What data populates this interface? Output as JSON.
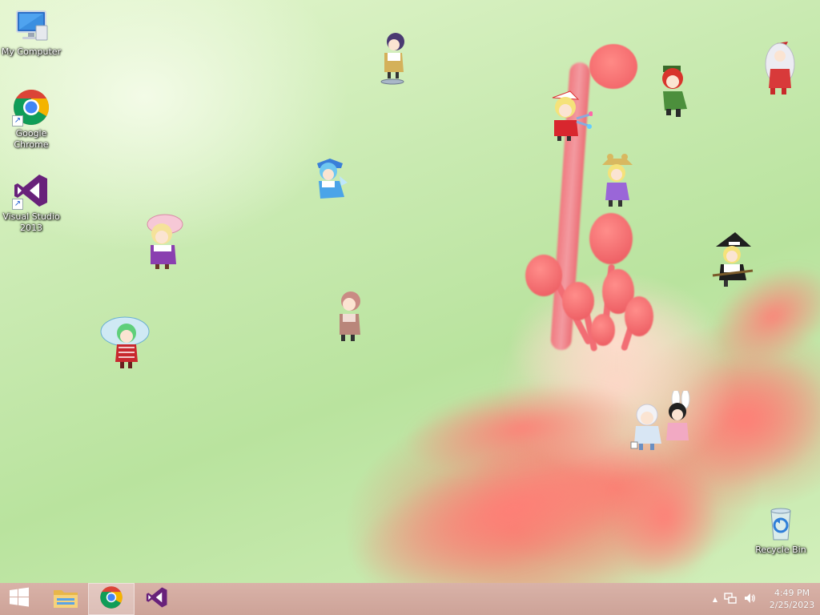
{
  "desktop_icons": [
    {
      "label": "My Computer",
      "icon": "computer-icon"
    },
    {
      "label": "Google Chrome",
      "icon": "chrome-icon"
    },
    {
      "label": "Visual Studio 2013",
      "icon": "visual-studio-icon"
    },
    {
      "label": "Recycle Bin",
      "icon": "recycle-bin-icon"
    }
  ],
  "taskbar": {
    "start_icon": "windows-start-icon",
    "pinned": [
      {
        "name": "File Explorer",
        "icon": "folder-icon",
        "active": false
      },
      {
        "name": "Google Chrome",
        "icon": "chrome-icon",
        "active": true
      },
      {
        "name": "Visual Studio",
        "icon": "visual-studio-icon",
        "active": false
      }
    ],
    "tray": {
      "overflow_glyph": "▲",
      "network_icon": "network-icon",
      "volume_icon": "speaker-icon",
      "time": "4:49 PM",
      "date": "2/25/2023"
    }
  },
  "colors": {
    "taskbar": "#d0a69b",
    "wallpaper_green": "#c9eab1",
    "flower_pink": "#f07a80"
  }
}
